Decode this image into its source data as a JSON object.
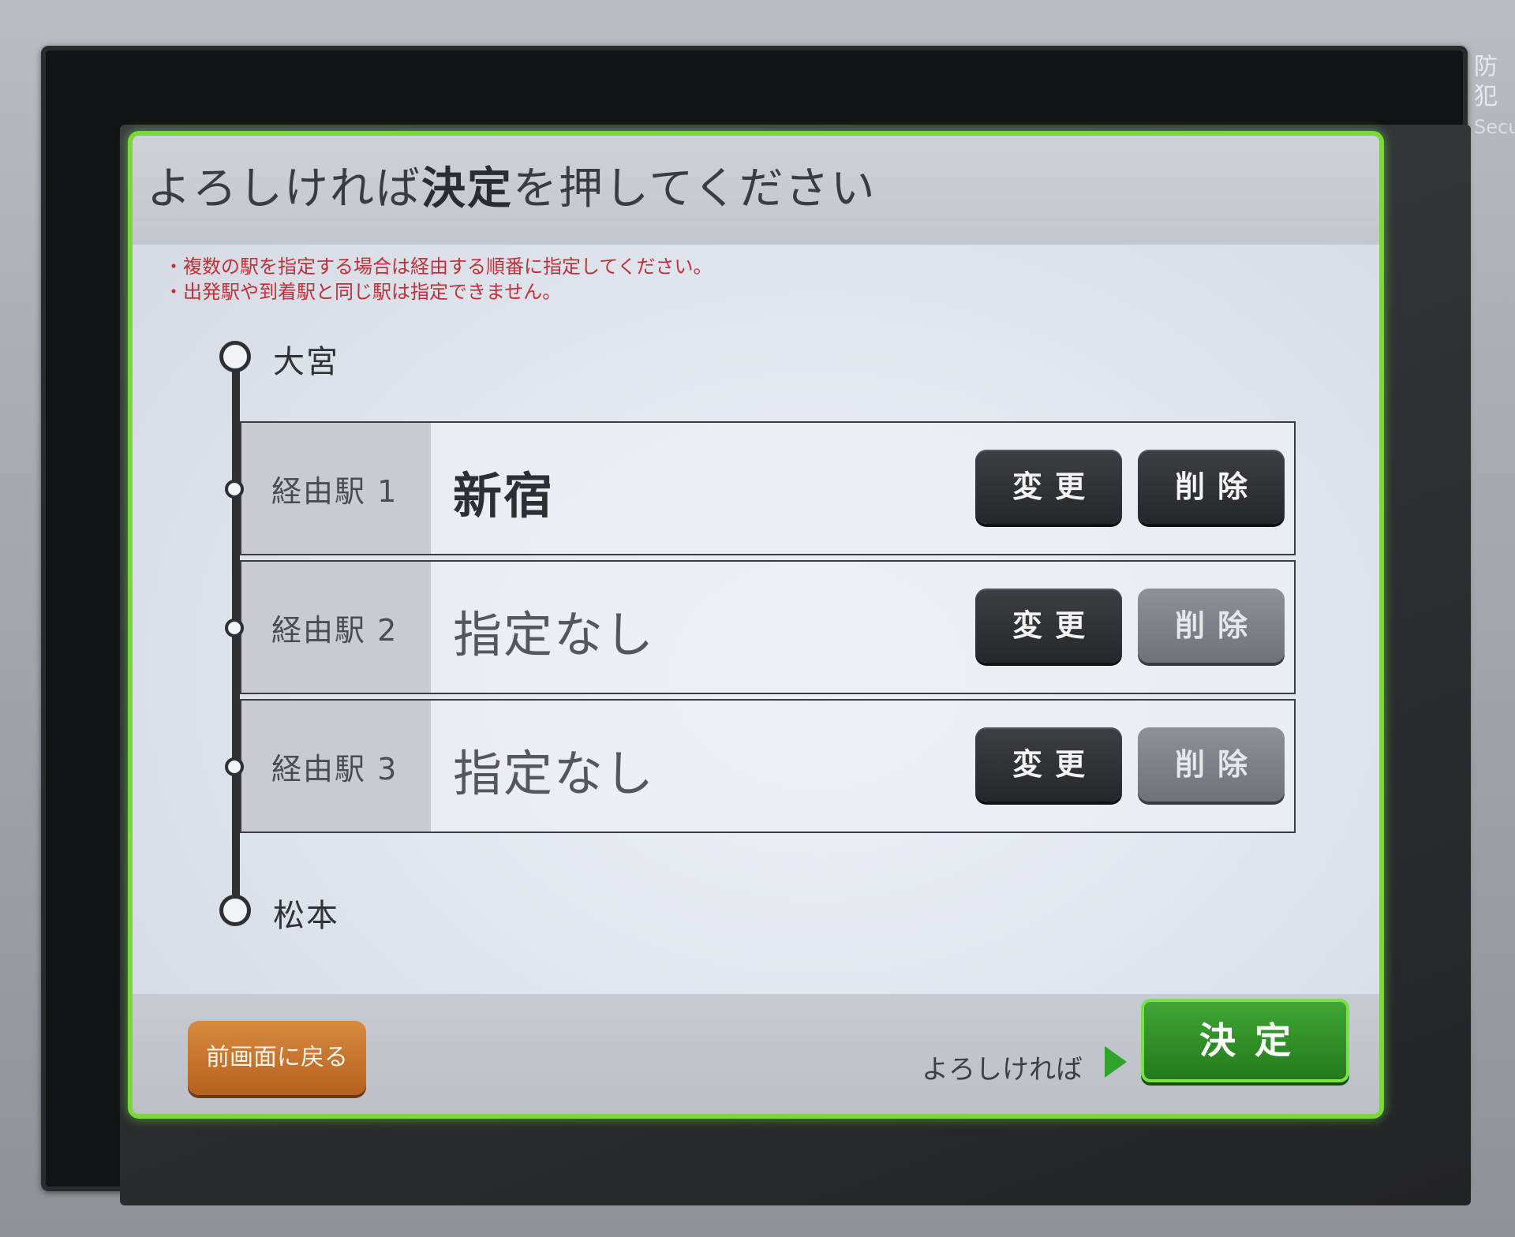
{
  "corner": {
    "line1": "防犯",
    "line2": "Secu"
  },
  "header": {
    "title_prefix": "よろしければ",
    "title_bold": "決定",
    "title_suffix": "を押してください"
  },
  "notes": [
    "・複数の駅を指定する場合は経由する順番に指定してください。",
    "・出発駅や到着駅と同じ駅は指定できません。"
  ],
  "route": {
    "origin": "大宮",
    "destination": "松本",
    "via": [
      {
        "label": "経由駅 1",
        "value": "新宿",
        "change_label": "変更",
        "delete_label": "削除"
      },
      {
        "label": "経由駅 2",
        "value": "指定なし",
        "change_label": "変更",
        "delete_label": "削除"
      },
      {
        "label": "経由駅 3",
        "value": "指定なし",
        "change_label": "変更",
        "delete_label": "削除"
      }
    ]
  },
  "footer": {
    "back_label": "前画面に戻る",
    "hint": "よろしければ",
    "ok_label": "決定"
  },
  "colors": {
    "frame": "#7bd83c",
    "notes_text": "#c0303a",
    "ok_button": "#2f8f27",
    "back_button": "#c67430"
  }
}
